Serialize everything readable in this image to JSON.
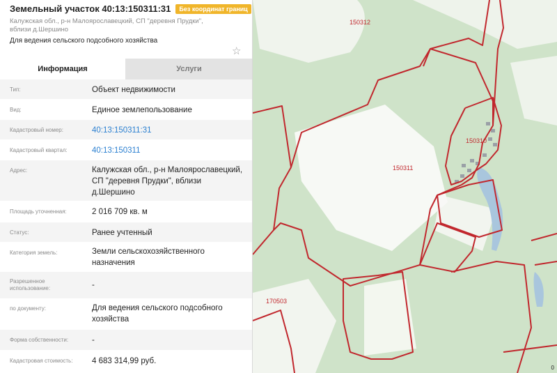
{
  "parcel": {
    "title": "Земельный участок 40:13:150311:31",
    "badge": "Без координат границ",
    "address_short": "Калужская обл., р-н Малоярославецкий, СП \"деревня Прудки\", вблизи д.Шершино",
    "purpose": "Для ведения сельского подсобного хозяйства",
    "star_icon": "star-icon"
  },
  "tabs": [
    {
      "label": "Информация",
      "active": true
    },
    {
      "label": "Услуги",
      "active": false
    }
  ],
  "rows": [
    {
      "label": "Тип:",
      "value": "Объект недвижимости",
      "link": false
    },
    {
      "label": "Вид:",
      "value": "Единое землепользование",
      "link": false
    },
    {
      "label": "Кадастровый номер:",
      "value": "40:13:150311:31",
      "link": true
    },
    {
      "label": "Кадастровый квартал:",
      "value": "40:13:150311",
      "link": true
    },
    {
      "label": "Адрес:",
      "value": "Калужская обл., р-н Малоярославецкий, СП \"деревня Прудки\", вблизи д.Шершино",
      "link": false
    },
    {
      "label": "Площадь уточненная:",
      "value": "2 016 709 кв. м",
      "link": false
    },
    {
      "label": "Статус:",
      "value": "Ранее учтенный",
      "link": false
    },
    {
      "label": "Категория земель:",
      "value": "Земли сельскохозяйственного назначения",
      "link": false
    },
    {
      "label": "Разрешенное использование:",
      "value": "-",
      "link": false
    },
    {
      "label": "по документу:",
      "value": "Для ведения сельского подсобного хозяйства",
      "link": false
    },
    {
      "label": "Форма собственности:",
      "value": "-",
      "link": false
    },
    {
      "label": "Кадастровая стоимость:",
      "value": "4 683 314,99 руб.",
      "link": false
    }
  ],
  "map": {
    "labels": [
      "150312",
      "150310",
      "150311",
      "170503"
    ],
    "scale_text": "0",
    "boundary_color": "#c1272d",
    "forest_color": "#cfe3c9",
    "field_color": "#f8f8f6",
    "water_color": "#a9c6dd"
  }
}
